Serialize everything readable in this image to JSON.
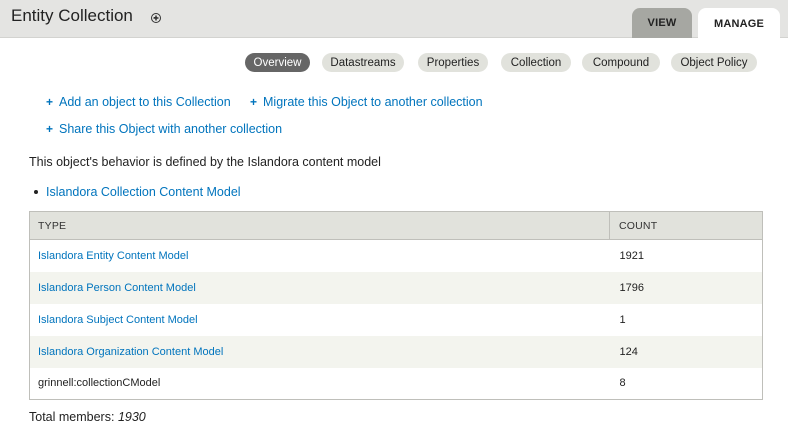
{
  "header": {
    "title": "Entity Collection",
    "tabs": {
      "view": "VIEW",
      "manage": "MANAGE"
    }
  },
  "secondary_tabs": [
    "Overview",
    "Datastreams",
    "Properties",
    "Collection",
    "Compound",
    "Object Policy"
  ],
  "actions": {
    "add_object": "Add an object to this Collection",
    "migrate": "Migrate this Object to another collection",
    "share": "Share this Object with another collection"
  },
  "behavior_text": "This object's behavior is defined by the Islandora content model",
  "content_model": "Islandora Collection Content Model",
  "table": {
    "headers": {
      "type": "TYPE",
      "count": "COUNT"
    },
    "rows": [
      {
        "type": "Islandora Entity Content Model",
        "count": "1921"
      },
      {
        "type": "Islandora Person Content Model",
        "count": "1796"
      },
      {
        "type": "Islandora Subject Content Model",
        "count": "1"
      },
      {
        "type": "Islandora Organization Content Model",
        "count": "124"
      },
      {
        "type": "grinnell:collectionCModel",
        "count": "8"
      }
    ]
  },
  "total": {
    "label": "Total members:",
    "value": "1930"
  },
  "colors": {
    "link": "#0074bd",
    "active_tab": "#666666",
    "header_bg": "#e4e4e2"
  }
}
